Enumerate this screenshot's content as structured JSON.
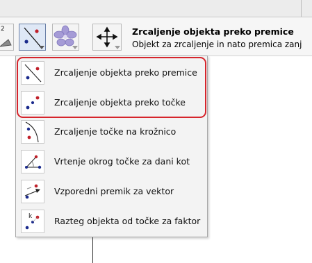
{
  "toolbar": {
    "title": "Zrcaljenje objekta preko premice",
    "subtitle": "Objekt za zrcaljenje in nato premica zanj",
    "buttons": [
      {
        "icon": "reflect-line-icon"
      },
      {
        "icon": "flower-icon"
      },
      {
        "icon": "move-view-icon"
      }
    ],
    "partial_button_label": "2"
  },
  "menu": {
    "items": [
      {
        "label": "Zrcaljenje objekta preko premice",
        "icon": "reflect-about-line-icon"
      },
      {
        "label": "Zrcaljenje objekta preko točke",
        "icon": "reflect-about-point-icon"
      },
      {
        "label": "Zrcaljenje točke na krožnico",
        "icon": "reflect-about-circle-icon"
      },
      {
        "label": "Vrtenje okrog točke za dani kot",
        "icon": "rotate-around-point-icon"
      },
      {
        "label": "Vzporedni premik za vektor",
        "icon": "translate-by-vector-icon"
      },
      {
        "label": "Razteg objekta od točke za faktor",
        "icon": "dilate-from-point-icon"
      }
    ],
    "dilate_icon_letter": "k"
  },
  "colors": {
    "highlight": "#d6252c",
    "blue_point": "#1a2a8c",
    "red_point": "#c0202a",
    "active_button_bg": "#dfe8f6"
  }
}
